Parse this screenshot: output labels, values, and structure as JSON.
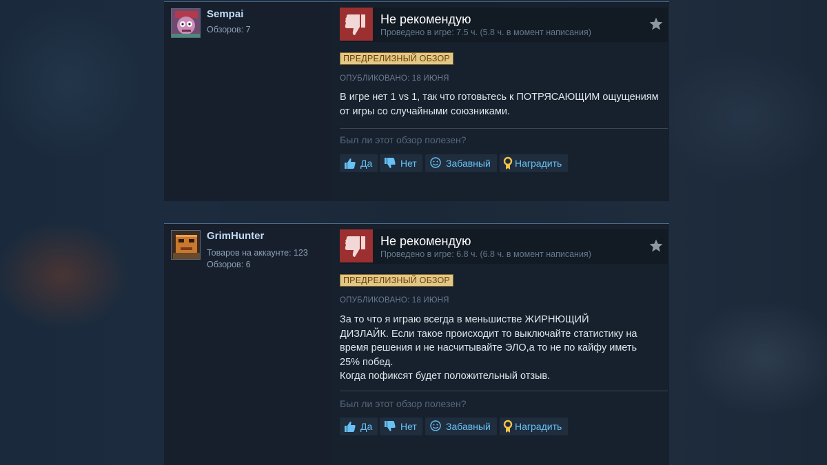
{
  "reviews": [
    {
      "username": "Sempai",
      "stats": [
        "Обзоров: 7"
      ],
      "verdict": "Не рекомендую",
      "hours": "Проведено в игре: 7.5 ч. (5.8 ч. в момент написания)",
      "badge": "ПРЕДРЕЛИЗНЫЙ ОБЗОР",
      "posted": "ОПУБЛИКОВАНО: 18 ИЮНЯ",
      "text": "В игре нет 1 vs 1, так что готовьтесь к ПОТРЯСАЮЩИМ ощущениям от игры со случайными союзниками.",
      "helpful_question": "Был ли этот обзор полезен?",
      "buttons": {
        "yes": "Да",
        "no": "Нет",
        "funny": "Забавный",
        "award": "Наградить"
      }
    },
    {
      "username": "GrimHunter",
      "stats": [
        "Товаров на аккаунте: 123",
        "Обзоров: 6"
      ],
      "verdict": "Не рекомендую",
      "hours": "Проведено в игре: 6.8 ч. (6.8 ч. в момент написания)",
      "badge": "ПРЕДРЕЛИЗНЫЙ ОБЗОР",
      "posted": "ОПУБЛИКОВАНО: 18 ИЮНЯ",
      "text_lines": [
        "За то что я играю всегда в меньшистве ЖИРНЮЩИЙ",
        "ДИЗЛАЙК. Если такое происходит то выключайте статистику на",
        "время решения и не насчитывайте ЭЛО,а то не по кайфу иметь",
        "25% побед.",
        "Когда пофиксят будет положительный отзыв."
      ],
      "helpful_question": "Был ли этот обзор полезен?",
      "buttons": {
        "yes": "Да",
        "no": "Нет",
        "funny": "Забавный",
        "award": "Наградить"
      }
    }
  ],
  "colors": {
    "thumb_down_bg": "#9c2f2f",
    "badge_bg": "#e2c887",
    "link": "#67c1f5"
  },
  "icons": [
    "thumbs-down-icon",
    "star-icon",
    "thumbs-up-icon",
    "smiley-icon",
    "award-icon"
  ]
}
